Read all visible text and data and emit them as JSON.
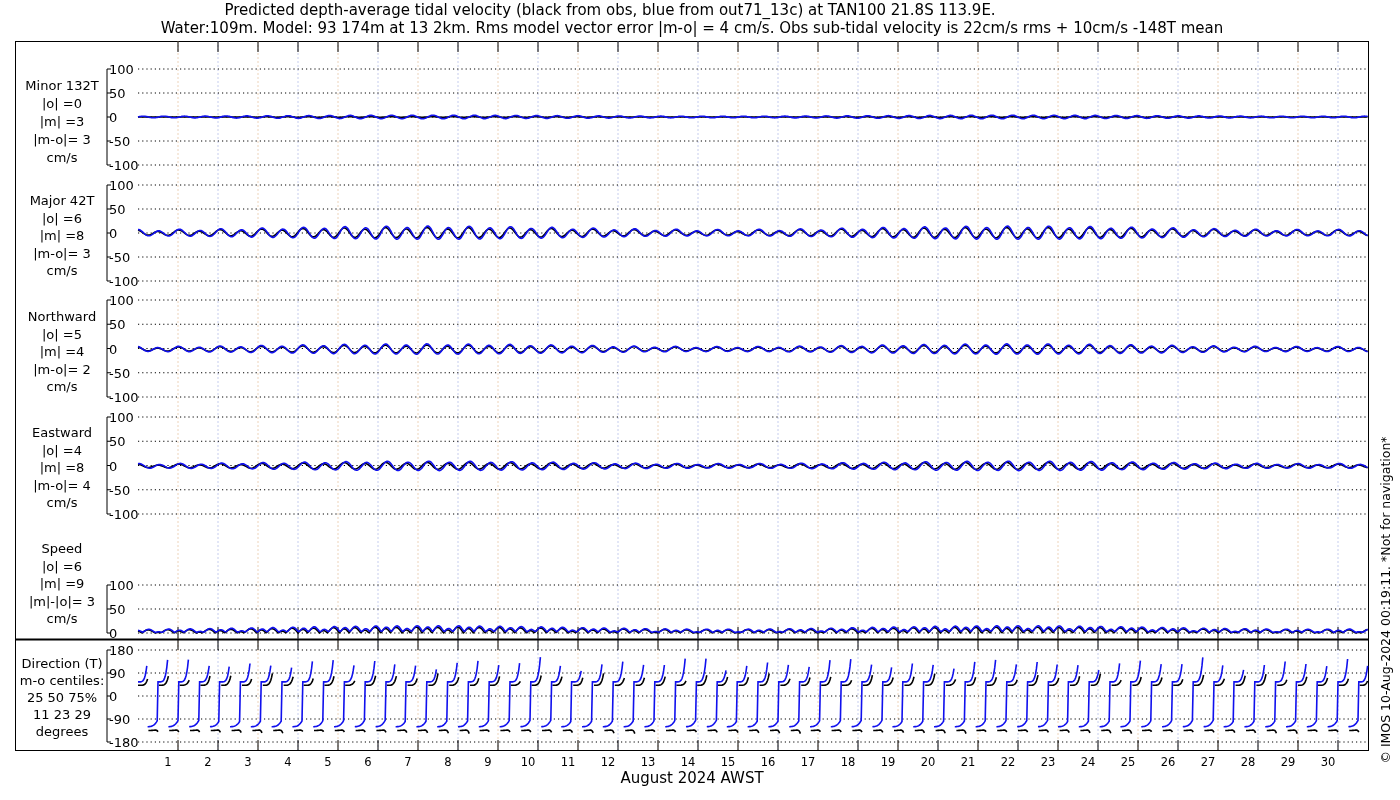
{
  "title": [
    "Predicted depth-average tidal velocity (black from obs, blue from out71_13c) at TAN100 21.8S 113.9E.",
    "Water:109m. Model: 93 174m at 13 2km. Rms model vector error |m-o| = 4 cm/s. Obs sub-tidal velocity is 22cm/s rms + 10cm/s -148T mean"
  ],
  "panels": [
    {
      "kind": "minor",
      "label_lines": [
        "Minor 132T",
        "|o| =0",
        "|m| =3",
        "|m-o|= 3",
        "cm/s"
      ],
      "yticks": [
        "100",
        "50",
        "0",
        "-50",
        "-100"
      ]
    },
    {
      "kind": "major",
      "label_lines": [
        "Major 42T",
        "|o| =6",
        "|m| =8",
        "|m-o|= 3",
        "cm/s"
      ],
      "yticks": [
        "100",
        "50",
        "0",
        "-50",
        "-100"
      ]
    },
    {
      "kind": "north",
      "label_lines": [
        "Northward",
        "|o| =5",
        "|m| =4",
        "|m-o|= 2",
        "cm/s"
      ],
      "yticks": [
        "100",
        "50",
        "0",
        "-50",
        "-100"
      ]
    },
    {
      "kind": "east",
      "label_lines": [
        "Eastward",
        "|o| =4",
        "|m| =8",
        "|m-o|= 4",
        "cm/s"
      ],
      "yticks": [
        "100",
        "50",
        "0",
        "-50",
        "-100"
      ]
    },
    {
      "kind": "speed",
      "label_lines": [
        "Speed",
        "|o| =6",
        "|m| =9",
        "|m|-|o|= 3",
        "cm/s"
      ],
      "yticks": [
        "100",
        "50",
        "0"
      ]
    },
    {
      "kind": "direction",
      "label_lines": [
        "Direction (T)",
        "m-o centiles:",
        "25  50  75%",
        "11  23  29",
        "degrees"
      ],
      "yticks": [
        "180",
        "90",
        "0",
        "-90",
        "-180"
      ]
    }
  ],
  "days": [
    "1",
    "2",
    "3",
    "4",
    "5",
    "6",
    "7",
    "8",
    "9",
    "10",
    "11",
    "12",
    "13",
    "14",
    "15",
    "16",
    "17",
    "18",
    "19",
    "20",
    "21",
    "22",
    "23",
    "24",
    "25",
    "26",
    "27",
    "28",
    "29",
    "30"
  ],
  "xlabel": "August 2024 AWST",
  "credit": "© IMOS 10-Aug-2024 00:19:11. *Not for navigation*"
}
